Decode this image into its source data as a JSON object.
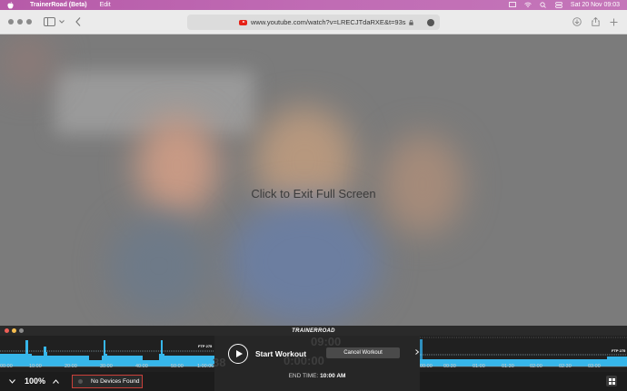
{
  "menubar": {
    "app_name": "TrainerRoad (Beta)",
    "menu_edit": "Edit",
    "date_time": "Sat 20 Nov  09:03"
  },
  "browser": {
    "url": "www.youtube.com/watch?v=LRECJTdaRXE&t=93s"
  },
  "video": {
    "exit_text": "Click to Exit Full Screen"
  },
  "app": {
    "logo": "TRAINERROAD",
    "chart_left": {
      "ftp_label": "FTP 275",
      "ticks": [
        "00:00",
        "10:00",
        "20:00",
        "30:00",
        "40:00",
        "50:00",
        "1:00:00"
      ]
    },
    "chart_right": {
      "ftp_label": "FTP 275",
      "ticks": [
        "00:00",
        "00:30",
        "01:00",
        "01:30",
        "02:00",
        "02:30",
        "03:00"
      ]
    },
    "start_label": "Start Workout",
    "cancel_label": "Cancel Workout",
    "ghost_top": "09:00",
    "ghost_bottom": "0:00:00",
    "ghost_left": "38",
    "end_time_label": "END TIME:",
    "end_time_value": "10:00 AM",
    "zoom": "100%",
    "devices": "No Devices Found"
  }
}
